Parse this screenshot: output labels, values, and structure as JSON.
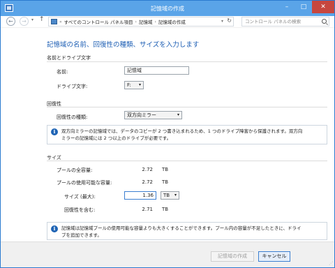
{
  "window": {
    "title": "記憶域の作成"
  },
  "titlebar": {
    "min_icon": "–",
    "max_icon": "□",
    "close_icon": "✕"
  },
  "nav": {
    "back_icon": "←",
    "forward_icon": "→",
    "recent_icon": "▾",
    "up_icon": "↑",
    "breadcrumb_lead": "«",
    "breadcrumb": [
      "すべてのコントロール パネル項目",
      "記憶域",
      "記憶域の作成"
    ],
    "separator": "›",
    "caret": "▾",
    "refresh_icon": "↻",
    "search_placeholder": "コントロール パネルの検索"
  },
  "main": {
    "heading": "記憶域の名前、回復性の種類、サイズを入力します",
    "name_section": {
      "title": "名前とドライブ文字",
      "name_label": "名前:",
      "name_value": "記憶域",
      "drive_label": "ドライブ文字:",
      "drive_value": "F:"
    },
    "resiliency_section": {
      "title": "回復性",
      "type_label": "回復性の種類:",
      "type_value": "双方向ミラー",
      "info_line1": "双方向ミラーの記憶域では、データのコピーが 2 つ書き込まれるため、1 つのドライブ障害から保護されます。双方向",
      "info_line2": "ミラーの記憶域には 2 つ以上のドライブが必要です。"
    },
    "size_section": {
      "title": "サイズ",
      "total_label": "プールの全容量:",
      "total_value": "2.72",
      "total_unit": "TB",
      "available_label": "プールの使用可能な容量:",
      "available_value": "2.72",
      "available_unit": "TB",
      "size_label": "サイズ (最大):",
      "size_value": "1.36",
      "size_unit": "TB",
      "incl_label": "回復性を含む:",
      "incl_value": "2.71",
      "incl_unit": "TB",
      "info_line1": "記憶域は記憶域プールの使用可能な容量よりも大きくすることができます。プール内の容量が不足したときに、ドライ",
      "info_line2": "ブを追加できます。"
    }
  },
  "footer": {
    "create_label": "記憶域の作成",
    "cancel_label": "キャンセル"
  },
  "info_icon": "i",
  "colors": {
    "accent": "#1e5fb4",
    "titlebar": "#5aa4e8",
    "close": "#c7463e"
  }
}
